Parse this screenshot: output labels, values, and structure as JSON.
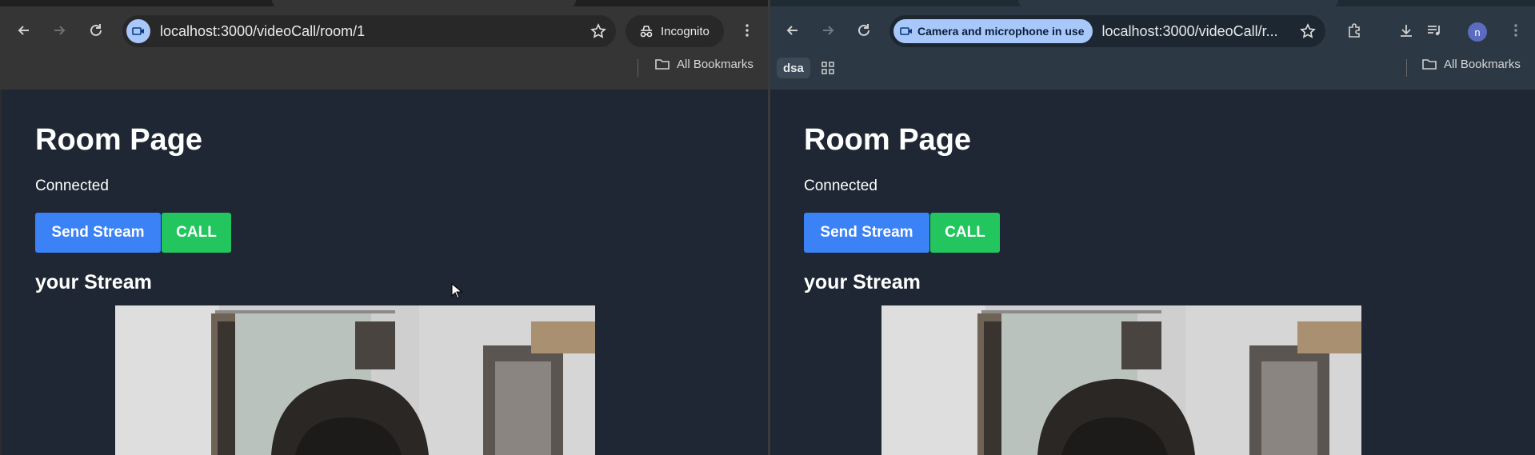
{
  "left_window": {
    "url": "localhost:3000/videoCall/room/1",
    "incognito_label": "Incognito",
    "bookmarks_label": "All Bookmarks",
    "page": {
      "title": "Room Page",
      "status": "Connected",
      "send_stream_label": "Send Stream",
      "call_label": "CALL",
      "stream_heading": "your Stream"
    }
  },
  "right_window": {
    "camera_chip_label": "Camera and microphone in use",
    "url": "localhost:3000/videoCall/r...",
    "bookmark_folder": "dsa",
    "bookmarks_label": "All Bookmarks",
    "avatar_initial": "n",
    "page": {
      "title": "Room Page",
      "status": "Connected",
      "send_stream_label": "Send Stream",
      "call_label": "CALL",
      "stream_heading": "your Stream"
    }
  },
  "colors": {
    "page_bg": "#1e2733",
    "send_button": "#3b82f6",
    "call_button": "#22c55e",
    "chip": "#a8c7fa"
  }
}
